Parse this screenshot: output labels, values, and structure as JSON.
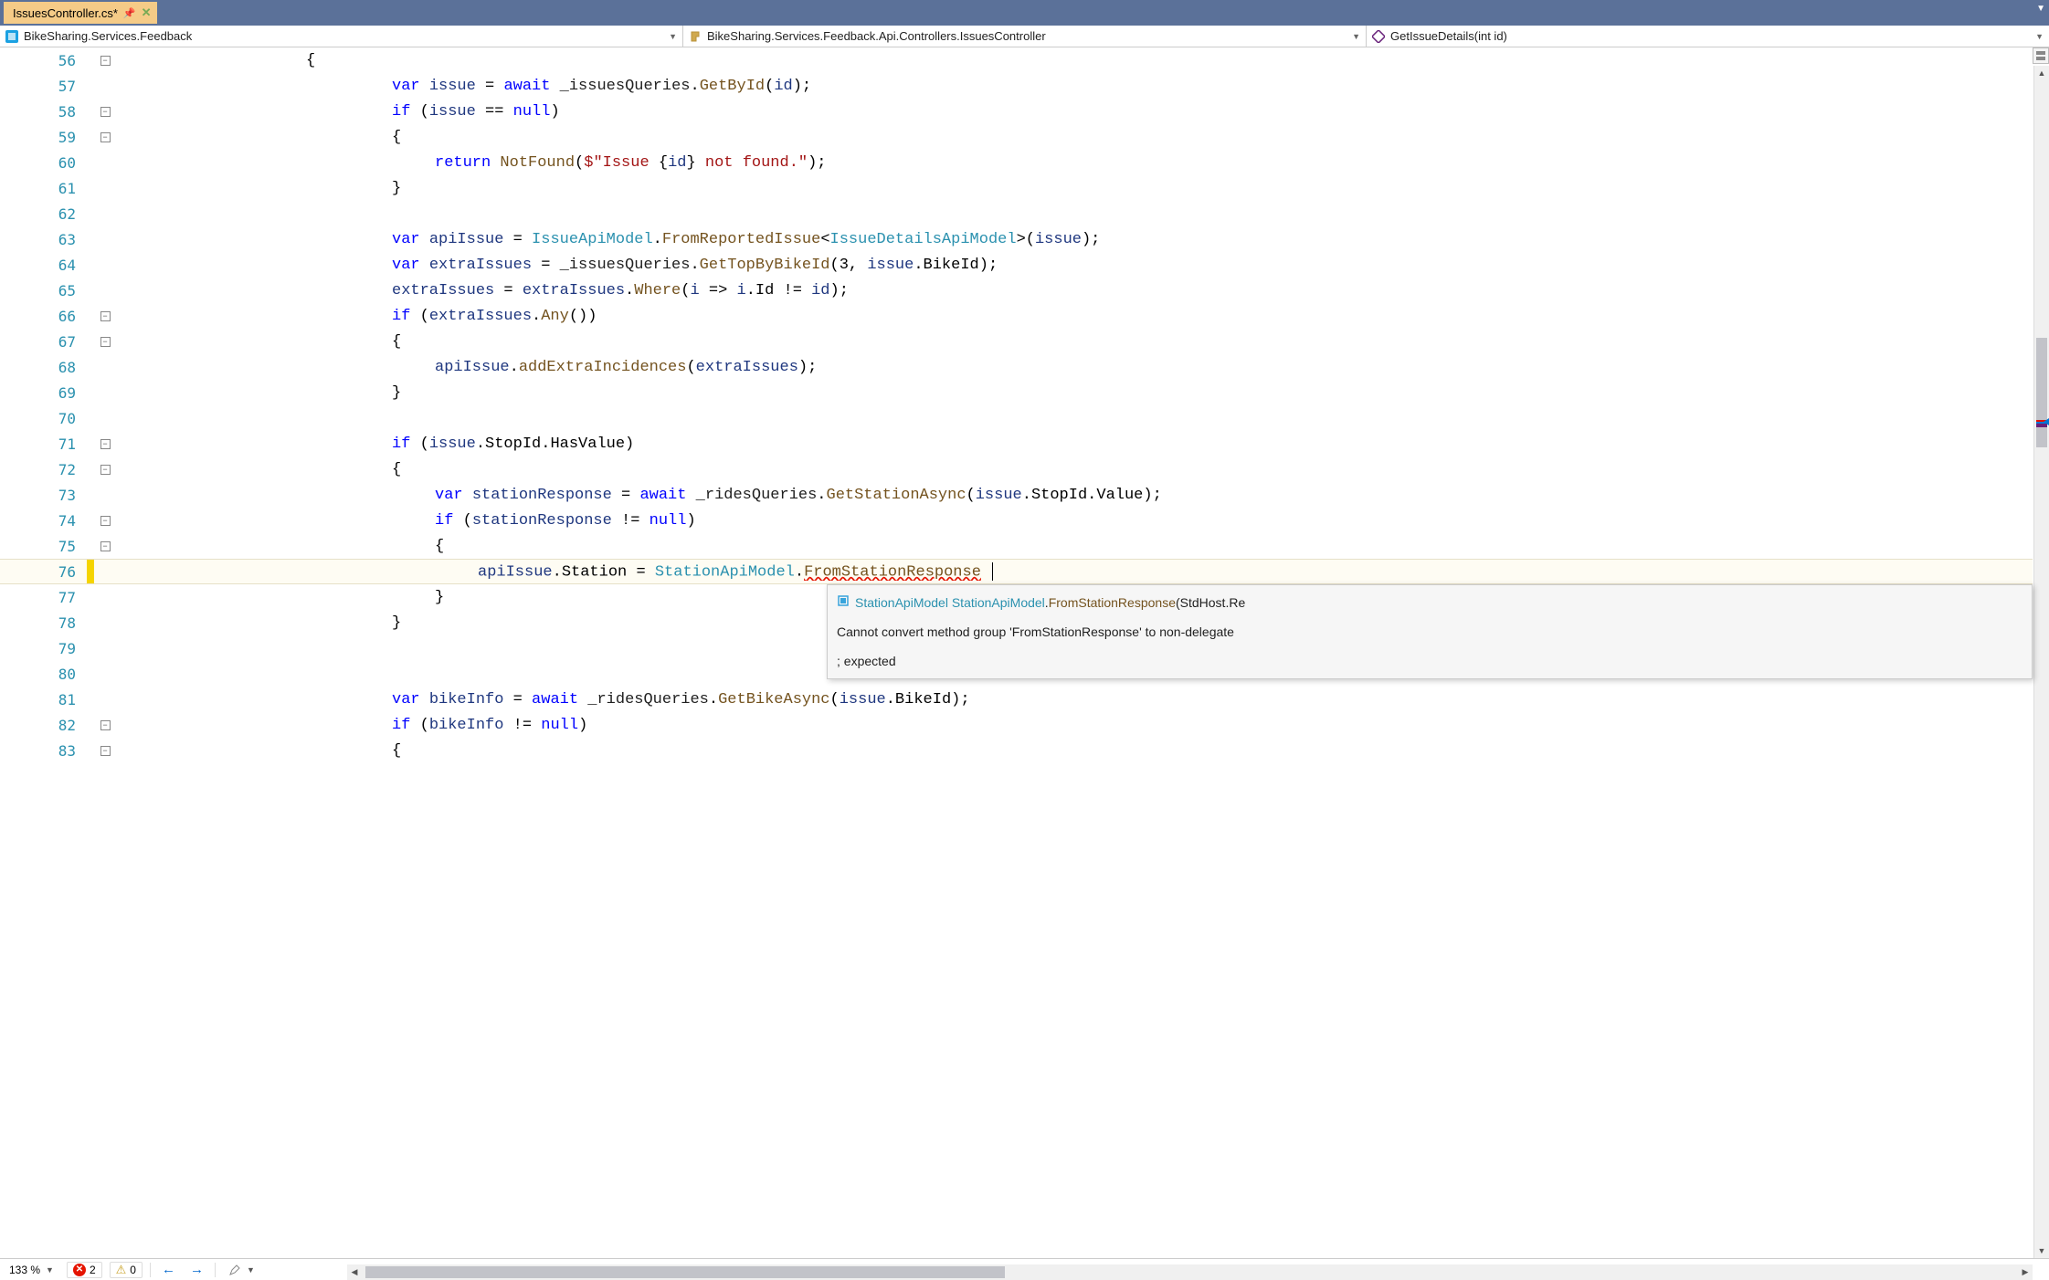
{
  "tab": {
    "filename": "IssuesController.cs*",
    "pinned": true
  },
  "nav": {
    "namespace": "BikeSharing.Services.Feedback",
    "class": "BikeSharing.Services.Feedback.Api.Controllers.IssuesController",
    "member": "GetIssueDetails(int id)"
  },
  "lines": [
    {
      "n": 56,
      "fold": "minus",
      "indent": 4,
      "tokens": [
        {
          "t": "{",
          "c": ""
        }
      ]
    },
    {
      "n": 57,
      "indent": 6,
      "tokens": [
        {
          "t": "var ",
          "c": "kw"
        },
        {
          "t": "issue",
          "c": "ident"
        },
        {
          "t": " = ",
          "c": ""
        },
        {
          "t": "await ",
          "c": "kw"
        },
        {
          "t": "_issuesQueries",
          "c": "member"
        },
        {
          "t": ".",
          "c": ""
        },
        {
          "t": "GetById",
          "c": "method"
        },
        {
          "t": "(",
          "c": ""
        },
        {
          "t": "id",
          "c": "ident"
        },
        {
          "t": ");",
          "c": ""
        }
      ]
    },
    {
      "n": 58,
      "fold": "minus",
      "indent": 6,
      "tokens": [
        {
          "t": "if ",
          "c": "kw"
        },
        {
          "t": "(",
          "c": ""
        },
        {
          "t": "issue",
          "c": "ident"
        },
        {
          "t": " == ",
          "c": ""
        },
        {
          "t": "null",
          "c": "kw"
        },
        {
          "t": ")",
          "c": ""
        }
      ]
    },
    {
      "n": 59,
      "fold": "minus",
      "indent": 6,
      "tokens": [
        {
          "t": "{",
          "c": ""
        }
      ]
    },
    {
      "n": 60,
      "indent": 7,
      "tokens": [
        {
          "t": "return ",
          "c": "kw"
        },
        {
          "t": "NotFound",
          "c": "method"
        },
        {
          "t": "(",
          "c": ""
        },
        {
          "t": "$\"Issue ",
          "c": "str"
        },
        {
          "t": "{",
          "c": ""
        },
        {
          "t": "id",
          "c": "ident"
        },
        {
          "t": "}",
          "c": ""
        },
        {
          "t": " not found.\"",
          "c": "str"
        },
        {
          "t": ");",
          "c": ""
        }
      ]
    },
    {
      "n": 61,
      "indent": 6,
      "tokens": [
        {
          "t": "}",
          "c": ""
        }
      ]
    },
    {
      "n": 62,
      "indent": 0,
      "tokens": []
    },
    {
      "n": 63,
      "indent": 6,
      "tokens": [
        {
          "t": "var ",
          "c": "kw"
        },
        {
          "t": "apiIssue",
          "c": "ident"
        },
        {
          "t": " = ",
          "c": ""
        },
        {
          "t": "IssueApiModel",
          "c": "type"
        },
        {
          "t": ".",
          "c": ""
        },
        {
          "t": "FromReportedIssue",
          "c": "method"
        },
        {
          "t": "<",
          "c": ""
        },
        {
          "t": "IssueDetailsApiModel",
          "c": "type"
        },
        {
          "t": ">(",
          "c": ""
        },
        {
          "t": "issue",
          "c": "ident"
        },
        {
          "t": ");",
          "c": ""
        }
      ]
    },
    {
      "n": 64,
      "indent": 6,
      "tokens": [
        {
          "t": "var ",
          "c": "kw"
        },
        {
          "t": "extraIssues",
          "c": "ident"
        },
        {
          "t": " = ",
          "c": ""
        },
        {
          "t": "_issuesQueries",
          "c": "member"
        },
        {
          "t": ".",
          "c": ""
        },
        {
          "t": "GetTopByBikeId",
          "c": "method"
        },
        {
          "t": "(3, ",
          "c": ""
        },
        {
          "t": "issue",
          "c": "ident"
        },
        {
          "t": ".BikeId);",
          "c": ""
        }
      ]
    },
    {
      "n": 65,
      "indent": 6,
      "tokens": [
        {
          "t": "extraIssues",
          "c": "ident"
        },
        {
          "t": " = ",
          "c": ""
        },
        {
          "t": "extraIssues",
          "c": "ident"
        },
        {
          "t": ".",
          "c": ""
        },
        {
          "t": "Where",
          "c": "method"
        },
        {
          "t": "(",
          "c": ""
        },
        {
          "t": "i",
          "c": "ident"
        },
        {
          "t": " => ",
          "c": ""
        },
        {
          "t": "i",
          "c": "ident"
        },
        {
          "t": ".Id != ",
          "c": ""
        },
        {
          "t": "id",
          "c": "ident"
        },
        {
          "t": ");",
          "c": ""
        }
      ]
    },
    {
      "n": 66,
      "fold": "minus",
      "indent": 6,
      "tokens": [
        {
          "t": "if ",
          "c": "kw"
        },
        {
          "t": "(",
          "c": ""
        },
        {
          "t": "extraIssues",
          "c": "ident"
        },
        {
          "t": ".",
          "c": ""
        },
        {
          "t": "Any",
          "c": "method"
        },
        {
          "t": "())",
          "c": ""
        }
      ]
    },
    {
      "n": 67,
      "fold": "minus",
      "indent": 6,
      "tokens": [
        {
          "t": "{",
          "c": ""
        }
      ]
    },
    {
      "n": 68,
      "indent": 7,
      "tokens": [
        {
          "t": "apiIssue",
          "c": "ident"
        },
        {
          "t": ".",
          "c": ""
        },
        {
          "t": "addExtraIncidences",
          "c": "method"
        },
        {
          "t": "(",
          "c": ""
        },
        {
          "t": "extraIssues",
          "c": "ident"
        },
        {
          "t": ");",
          "c": ""
        }
      ]
    },
    {
      "n": 69,
      "indent": 6,
      "tokens": [
        {
          "t": "}",
          "c": ""
        }
      ]
    },
    {
      "n": 70,
      "indent": 0,
      "tokens": []
    },
    {
      "n": 71,
      "fold": "minus",
      "indent": 6,
      "tokens": [
        {
          "t": "if ",
          "c": "kw"
        },
        {
          "t": "(",
          "c": ""
        },
        {
          "t": "issue",
          "c": "ident"
        },
        {
          "t": ".StopId.HasValue)",
          "c": ""
        }
      ]
    },
    {
      "n": 72,
      "fold": "minus",
      "indent": 6,
      "tokens": [
        {
          "t": "{",
          "c": ""
        }
      ]
    },
    {
      "n": 73,
      "indent": 7,
      "tokens": [
        {
          "t": "var ",
          "c": "kw"
        },
        {
          "t": "stationResponse",
          "c": "ident"
        },
        {
          "t": " = ",
          "c": ""
        },
        {
          "t": "await ",
          "c": "kw"
        },
        {
          "t": "_ridesQueries",
          "c": "member"
        },
        {
          "t": ".",
          "c": ""
        },
        {
          "t": "GetStationAsync",
          "c": "method"
        },
        {
          "t": "(",
          "c": ""
        },
        {
          "t": "issue",
          "c": "ident"
        },
        {
          "t": ".StopId.Value);",
          "c": ""
        }
      ]
    },
    {
      "n": 74,
      "fold": "minus",
      "indent": 7,
      "tokens": [
        {
          "t": "if ",
          "c": "kw"
        },
        {
          "t": "(",
          "c": ""
        },
        {
          "t": "stationResponse",
          "c": "ident"
        },
        {
          "t": " != ",
          "c": ""
        },
        {
          "t": "null",
          "c": "kw"
        },
        {
          "t": ")",
          "c": ""
        }
      ]
    },
    {
      "n": 75,
      "fold": "minus",
      "indent": 7,
      "tokens": [
        {
          "t": "{",
          "c": ""
        }
      ]
    },
    {
      "n": 76,
      "indent": 8,
      "change": "yellow",
      "current": true,
      "tokens": [
        {
          "t": "apiIssue",
          "c": "ident"
        },
        {
          "t": ".Station = ",
          "c": ""
        },
        {
          "t": "StationApiModel",
          "c": "type"
        },
        {
          "t": ".",
          "c": ""
        },
        {
          "t": "FromStationResponse",
          "c": "method err-wave"
        },
        {
          "t": " ",
          "c": ""
        }
      ],
      "caret": true
    },
    {
      "n": 77,
      "indent": 7,
      "tokens": [
        {
          "t": "}",
          "c": ""
        }
      ]
    },
    {
      "n": 78,
      "indent": 6,
      "tokens": [
        {
          "t": "}",
          "c": ""
        }
      ]
    },
    {
      "n": 79,
      "indent": 0,
      "tokens": []
    },
    {
      "n": 80,
      "indent": 0,
      "tokens": []
    },
    {
      "n": 81,
      "indent": 6,
      "tokens": [
        {
          "t": "var ",
          "c": "kw"
        },
        {
          "t": "bikeInfo",
          "c": "ident"
        },
        {
          "t": " = ",
          "c": ""
        },
        {
          "t": "await ",
          "c": "kw"
        },
        {
          "t": "_ridesQueries",
          "c": "member"
        },
        {
          "t": ".",
          "c": ""
        },
        {
          "t": "GetBikeAsync",
          "c": "method"
        },
        {
          "t": "(",
          "c": ""
        },
        {
          "t": "issue",
          "c": "ident"
        },
        {
          "t": ".BikeId);",
          "c": ""
        }
      ]
    },
    {
      "n": 82,
      "fold": "minus",
      "indent": 6,
      "tokens": [
        {
          "t": "if ",
          "c": "kw"
        },
        {
          "t": "(",
          "c": ""
        },
        {
          "t": "bikeInfo",
          "c": "ident"
        },
        {
          "t": " != ",
          "c": ""
        },
        {
          "t": "null",
          "c": "kw"
        },
        {
          "t": ")",
          "c": ""
        }
      ]
    },
    {
      "n": 83,
      "fold": "minus",
      "indent": 6,
      "tokens": [
        {
          "t": "{",
          "c": ""
        }
      ]
    }
  ],
  "tooltip": {
    "sig_prefix": "StationApiModel",
    "sig_class": "StationApiModel",
    "sig_method": "FromStationResponse",
    "sig_suffix": "(StdHost.Re",
    "error1": "Cannot convert method group 'FromStationResponse' to non-delegate",
    "error2": "; expected"
  },
  "status": {
    "zoom": "133 %",
    "errors": "2",
    "warnings": "0"
  }
}
